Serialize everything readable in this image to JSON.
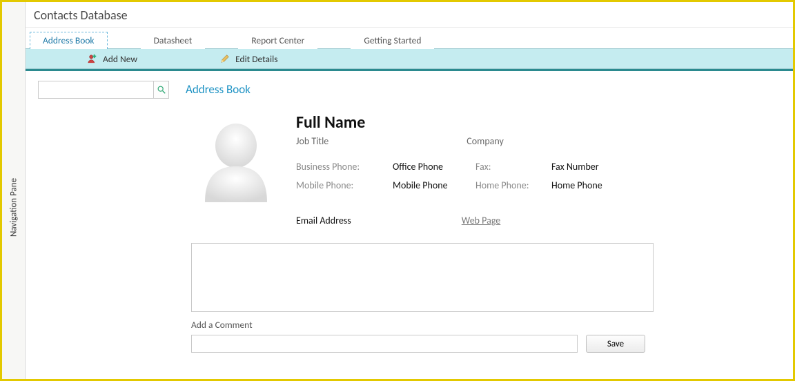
{
  "app": {
    "title": "Contacts Database"
  },
  "nav_pane": {
    "label": "Navigation Pane"
  },
  "tabs": [
    {
      "label": "Address Book",
      "active": true
    },
    {
      "label": "Datasheet",
      "active": false
    },
    {
      "label": "Report Center",
      "active": false
    },
    {
      "label": "Getting Started",
      "active": false
    }
  ],
  "toolbar": {
    "add_new": "Add New",
    "edit_details": "Edit Details"
  },
  "search": {
    "value": ""
  },
  "section_title": "Address Book",
  "contact": {
    "full_name": "Full Name",
    "job_title": "Job Title",
    "company": "Company",
    "labels": {
      "business_phone": "Business Phone:",
      "mobile_phone": "Mobile Phone:",
      "fax": "Fax:",
      "home_phone": "Home Phone:"
    },
    "values": {
      "office_phone": "Office Phone",
      "mobile_phone": "Mobile Phone",
      "fax_number": "Fax Number",
      "home_phone": "Home Phone"
    },
    "email": "Email Address",
    "web_page": "Web Page"
  },
  "comments": {
    "add_label": "Add a Comment",
    "save_label": "Save",
    "input_value": ""
  }
}
